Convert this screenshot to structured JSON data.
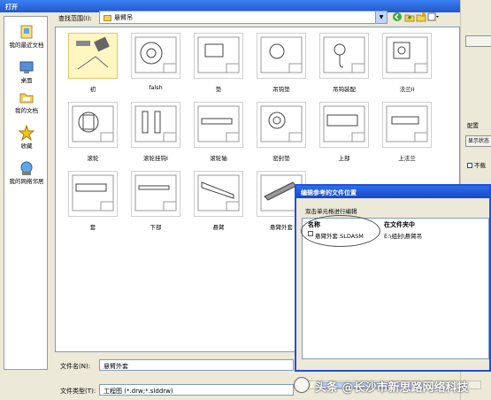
{
  "window": {
    "title": "打开"
  },
  "places": [
    {
      "label": "我的最近文档",
      "icon": "recent-documents-icon"
    },
    {
      "label": "桌面",
      "icon": "desktop-icon"
    },
    {
      "label": "我的文档",
      "icon": "my-documents-icon"
    },
    {
      "label": "收藏",
      "icon": "favorites-star-icon"
    },
    {
      "label": "我的网络邻居",
      "icon": "network-icon"
    }
  ],
  "lookin": {
    "label": "查找范围(I):",
    "value": "悬臂吊"
  },
  "files": [
    {
      "name": "初",
      "selected": true
    },
    {
      "name": "falsh",
      "selected": false
    },
    {
      "name": "垫",
      "selected": false
    },
    {
      "name": "吊钩垫",
      "selected": false
    },
    {
      "name": "吊钩装配",
      "selected": false
    },
    {
      "name": "法兰II",
      "selected": false
    },
    {
      "name": "滚轮",
      "selected": false
    },
    {
      "name": "滚轮挂钩I",
      "selected": false
    },
    {
      "name": "滚轮轴",
      "selected": false
    },
    {
      "name": "密封垫",
      "selected": false
    },
    {
      "name": "上部",
      "selected": false
    },
    {
      "name": "上法兰",
      "selected": false
    },
    {
      "name": "套",
      "selected": false
    },
    {
      "name": "下部",
      "selected": false
    },
    {
      "name": "悬臂",
      "selected": false
    },
    {
      "name": "悬臂外套",
      "selected": false
    }
  ],
  "filename": {
    "label": "文件名(N):",
    "value": "悬臂外套"
  },
  "filetype": {
    "label": "文件类型(T):",
    "value": "工程图 (*.drw;*.slddrw)"
  },
  "side": {
    "config": "配置",
    "show": "显示状态",
    "checkbox_label": "不载"
  },
  "dialog": {
    "title": "编辑参考的文件位置",
    "hint": "双击单元格进行编辑",
    "columns": [
      "名称",
      "在文件夹中"
    ],
    "rows": [
      {
        "name": "悬臂外套.SLDASM",
        "folder": "E:\\组封\\悬臂吊"
      }
    ]
  },
  "watermark": "头条 @长沙市新思路网络科技"
}
